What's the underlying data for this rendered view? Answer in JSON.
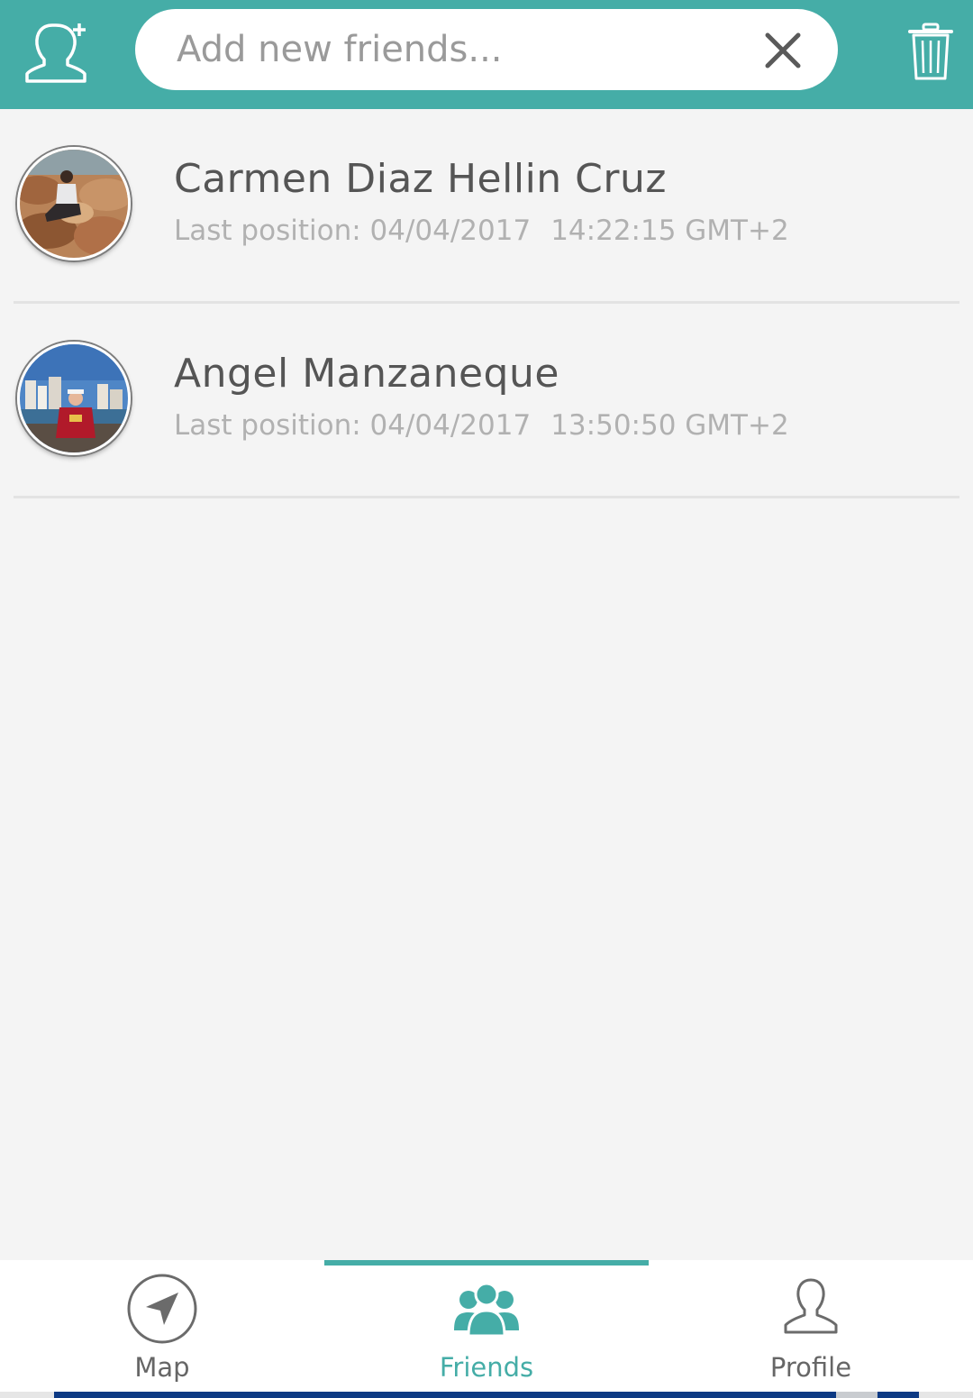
{
  "colors": {
    "accent": "#45ada7",
    "background": "#f4f4f4",
    "name_text": "#555555",
    "secondary_text": "#b1b1b1"
  },
  "header": {
    "add_friend_icon": "add-person-icon",
    "search": {
      "placeholder": "Add new friends...",
      "value": ""
    },
    "clear_icon": "close-icon",
    "trash_icon": "trash-icon"
  },
  "friends": [
    {
      "name": "Carmen Diaz Hellin Cruz",
      "position_label": "Last position: 04/04/2017",
      "time": "14:22:15 GMT+2"
    },
    {
      "name": "Angel Manzaneque",
      "position_label": "Last position: 04/04/2017",
      "time": "13:50:50 GMT+2"
    }
  ],
  "nav": {
    "active": "Friends",
    "tabs": [
      {
        "label": "Map",
        "icon": "navigation-arrow-icon"
      },
      {
        "label": "Friends",
        "icon": "group-icon"
      },
      {
        "label": "Profile",
        "icon": "person-icon"
      }
    ]
  }
}
